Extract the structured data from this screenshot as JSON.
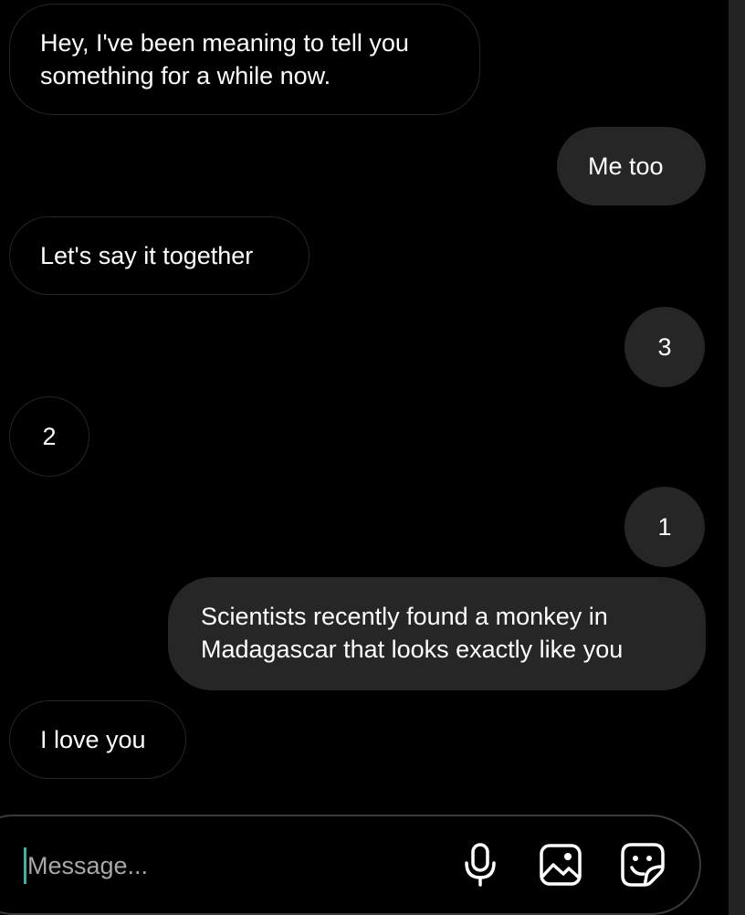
{
  "messages": [
    {
      "id": "msg1",
      "direction": "incoming",
      "text": [
        "Hey, I've been meaning to tell you",
        "something for a while now."
      ]
    },
    {
      "id": "msg2",
      "direction": "outgoing",
      "text": [
        "Me too"
      ]
    },
    {
      "id": "msg3",
      "direction": "incoming",
      "text": [
        "Let's say it together"
      ]
    },
    {
      "id": "msg4",
      "direction": "outgoing",
      "text": [
        "3"
      ]
    },
    {
      "id": "msg5",
      "direction": "incoming",
      "text": [
        "2"
      ]
    },
    {
      "id": "msg6",
      "direction": "outgoing",
      "text": [
        "1"
      ]
    },
    {
      "id": "msg7",
      "direction": "outgoing",
      "text": [
        "Scientists recently found a monkey in",
        "Madagascar that looks exactly like you"
      ]
    },
    {
      "id": "msg8",
      "direction": "incoming",
      "text": [
        "I love you"
      ]
    }
  ],
  "composer": {
    "placeholder": "Message...",
    "value": "",
    "icons": [
      "microphone-icon",
      "photo-icon",
      "sticker-icon"
    ]
  },
  "colors": {
    "background": "#000000",
    "outgoing_bubble": "#262626",
    "incoming_border": "#262626",
    "caret": "#35b6a3",
    "placeholder": "#a8a8a8"
  }
}
